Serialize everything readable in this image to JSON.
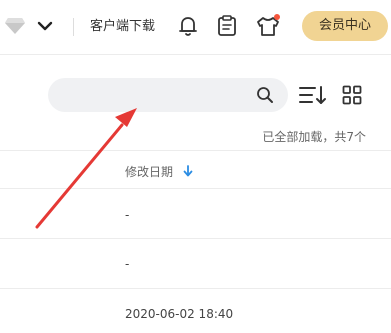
{
  "header": {
    "client_download_label": "客户端下载",
    "member_center_label": "会员中心",
    "notification_dot_color": "#f5553c",
    "member_button_color": "#f1d493"
  },
  "toolbar": {
    "search_placeholder": "",
    "icons": [
      "search-icon",
      "sort-list-icon",
      "grid-view-icon"
    ]
  },
  "list": {
    "count_text": "已全部加载，共7个",
    "columns": {
      "modified_date": "修改日期"
    },
    "sort_direction": "descending",
    "rows": [
      {
        "modified_date": "-"
      },
      {
        "modified_date": "-"
      },
      {
        "modified_date": "2020-06-02 18:40"
      }
    ]
  },
  "annotation": {
    "type": "arrow",
    "color": "#e53935"
  }
}
